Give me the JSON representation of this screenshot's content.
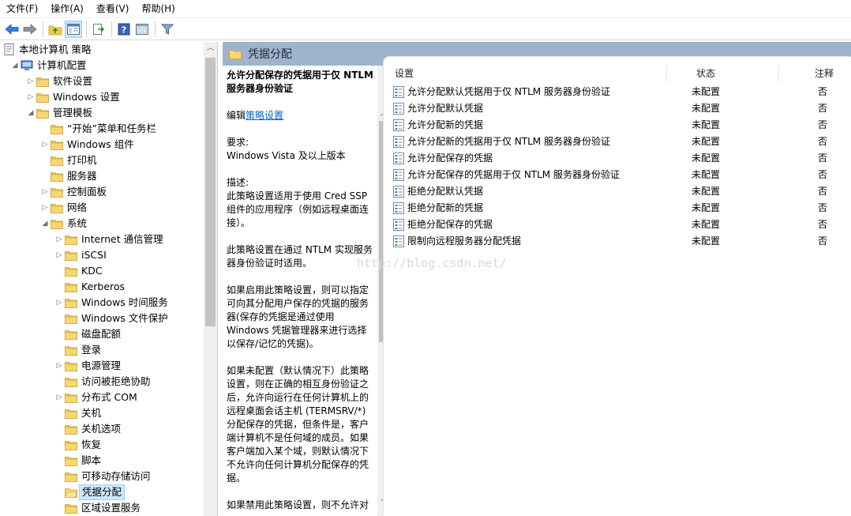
{
  "menu": [
    "文件(F)",
    "操作(A)",
    "查看(V)",
    "帮助(H)"
  ],
  "toolbar": {
    "buttons": [
      "back-arrow-icon",
      "forward-arrow-icon",
      "up-folder-icon",
      "show-hide-tree-icon",
      "export-list-icon",
      "help-icon",
      "properties-icon",
      "filter-icon"
    ]
  },
  "tree": [
    {
      "label": "本地计算机 策略",
      "level": 0,
      "arrow": "",
      "icon": "policy"
    },
    {
      "label": "计算机配置",
      "level": 1,
      "arrow": "◢",
      "icon": "computer"
    },
    {
      "label": "软件设置",
      "level": 2,
      "arrow": "▷",
      "icon": "folder"
    },
    {
      "label": "Windows 设置",
      "level": 2,
      "arrow": "▷",
      "icon": "folder"
    },
    {
      "label": "管理模板",
      "level": 2,
      "arrow": "◢",
      "icon": "folder"
    },
    {
      "label": "“开始”菜单和任务栏",
      "level": 3,
      "arrow": "",
      "icon": "folder"
    },
    {
      "label": "Windows 组件",
      "level": 3,
      "arrow": "▷",
      "icon": "folder"
    },
    {
      "label": "打印机",
      "level": 3,
      "arrow": "",
      "icon": "folder"
    },
    {
      "label": "服务器",
      "level": 3,
      "arrow": "",
      "icon": "folder"
    },
    {
      "label": "控制面板",
      "level": 3,
      "arrow": "▷",
      "icon": "folder"
    },
    {
      "label": "网络",
      "level": 3,
      "arrow": "▷",
      "icon": "folder"
    },
    {
      "label": "系统",
      "level": 3,
      "arrow": "◢",
      "icon": "folder"
    },
    {
      "label": "Internet 通信管理",
      "level": 4,
      "arrow": "▷",
      "icon": "folder"
    },
    {
      "label": "iSCSI",
      "level": 4,
      "arrow": "▷",
      "icon": "folder"
    },
    {
      "label": "KDC",
      "level": 4,
      "arrow": "",
      "icon": "folder"
    },
    {
      "label": "Kerberos",
      "level": 4,
      "arrow": "",
      "icon": "folder"
    },
    {
      "label": "Windows 时间服务",
      "level": 4,
      "arrow": "▷",
      "icon": "folder"
    },
    {
      "label": "Windows 文件保护",
      "level": 4,
      "arrow": "",
      "icon": "folder"
    },
    {
      "label": "磁盘配额",
      "level": 4,
      "arrow": "",
      "icon": "folder"
    },
    {
      "label": "登录",
      "level": 4,
      "arrow": "",
      "icon": "folder"
    },
    {
      "label": "电源管理",
      "level": 4,
      "arrow": "▷",
      "icon": "folder"
    },
    {
      "label": "访问被拒绝协助",
      "level": 4,
      "arrow": "",
      "icon": "folder"
    },
    {
      "label": "分布式 COM",
      "level": 4,
      "arrow": "▷",
      "icon": "folder"
    },
    {
      "label": "关机",
      "level": 4,
      "arrow": "",
      "icon": "folder"
    },
    {
      "label": "关机选项",
      "level": 4,
      "arrow": "",
      "icon": "folder"
    },
    {
      "label": "恢复",
      "level": 4,
      "arrow": "",
      "icon": "folder"
    },
    {
      "label": "脚本",
      "level": 4,
      "arrow": "",
      "icon": "folder"
    },
    {
      "label": "可移动存储访问",
      "level": 4,
      "arrow": "",
      "icon": "folder"
    },
    {
      "label": "凭据分配",
      "level": 4,
      "arrow": "",
      "icon": "folder-open",
      "selected": true
    },
    {
      "label": "区域设置服务",
      "level": 4,
      "arrow": "",
      "icon": "folder"
    }
  ],
  "header": {
    "title": "凭据分配"
  },
  "description": {
    "title": "允许分配保存的凭据用于仅 NTLM 服务器身份验证",
    "edit_prefix": "编辑",
    "edit_link": "策略设置",
    "req_label": "要求:",
    "req_value": "Windows Vista 及以上版本",
    "desc_label": "描述:",
    "p1": "此策略设置适用于使用 Cred SSP 组件的应用程序（例如远程桌面连接）。",
    "p2": "此策略设置在通过 NTLM 实现服务器身份验证时适用。",
    "p3": "如果启用此策略设置，则可以指定可向其分配用户保存的凭据的服务器(保存的凭据是通过使用 Windows 凭据管理器来进行选择以保存/记忆的凭据)。",
    "p4": "如果未配置（默认情况下）此策略设置，则在正确的相互身份验证之后，允许向运行在任何计算机上的远程桌面会话主机 (TERMSRV/*) 分配保存的凭据，但条件是，客户端计算机不是任何域的成员。如果客户端加入某个域，则默认情况下不允许向任何计算机分配保存的凭据。",
    "p5": "如果禁用此策略设置，则不允许对"
  },
  "columns": {
    "setting": "设置",
    "state": "状态",
    "note": "注释"
  },
  "rows": [
    {
      "name": "允许分配默认凭据用于仅 NTLM 服务器身份验证",
      "state": "未配置",
      "note": "否"
    },
    {
      "name": "允许分配默认凭据",
      "state": "未配置",
      "note": "否"
    },
    {
      "name": "允许分配新的凭据",
      "state": "未配置",
      "note": "否"
    },
    {
      "name": "允许分配新的凭据用于仅 NTLM 服务器身份验证",
      "state": "未配置",
      "note": "否"
    },
    {
      "name": "允许分配保存的凭据",
      "state": "未配置",
      "note": "否"
    },
    {
      "name": "允许分配保存的凭据用于仅 NTLM 服务器身份验证",
      "state": "未配置",
      "note": "否"
    },
    {
      "name": "拒绝分配默认凭据",
      "state": "未配置",
      "note": "否"
    },
    {
      "name": "拒绝分配新的凭据",
      "state": "未配置",
      "note": "否"
    },
    {
      "name": "拒绝分配保存的凭据",
      "state": "未配置",
      "note": "否"
    },
    {
      "name": "限制向远程服务器分配凭据",
      "state": "未配置",
      "note": "否"
    }
  ],
  "watermark": "http://blog.csdn.net/",
  "colors": {
    "header_bar": "#9fb4cc",
    "selection": "#cce8ff",
    "folder": "#f2c94c",
    "link": "#0066cc"
  }
}
